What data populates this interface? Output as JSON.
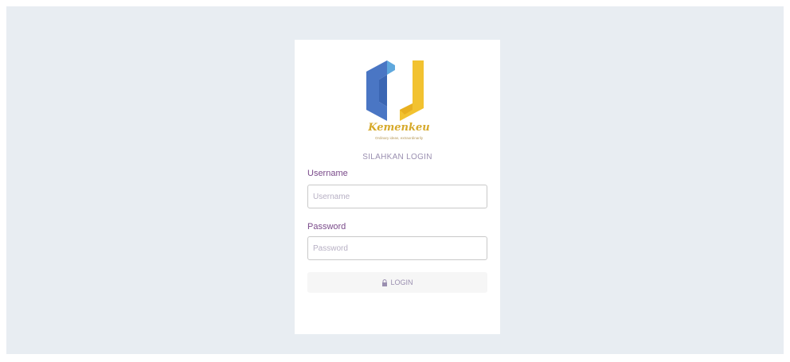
{
  "brand": {
    "name": "Kemenkeu",
    "tagline": "Ordinary ideas, extraordinarily",
    "colors": {
      "blue": "#4a76c4",
      "lightblue": "#5fa8dd",
      "yellow": "#f2c230"
    }
  },
  "login": {
    "heading": "SILAHKAN LOGIN",
    "username_label": "Username",
    "username_placeholder": "Username",
    "password_label": "Password",
    "password_placeholder": "Password",
    "button_label": "LOGIN",
    "button_icon": "lock-icon"
  }
}
